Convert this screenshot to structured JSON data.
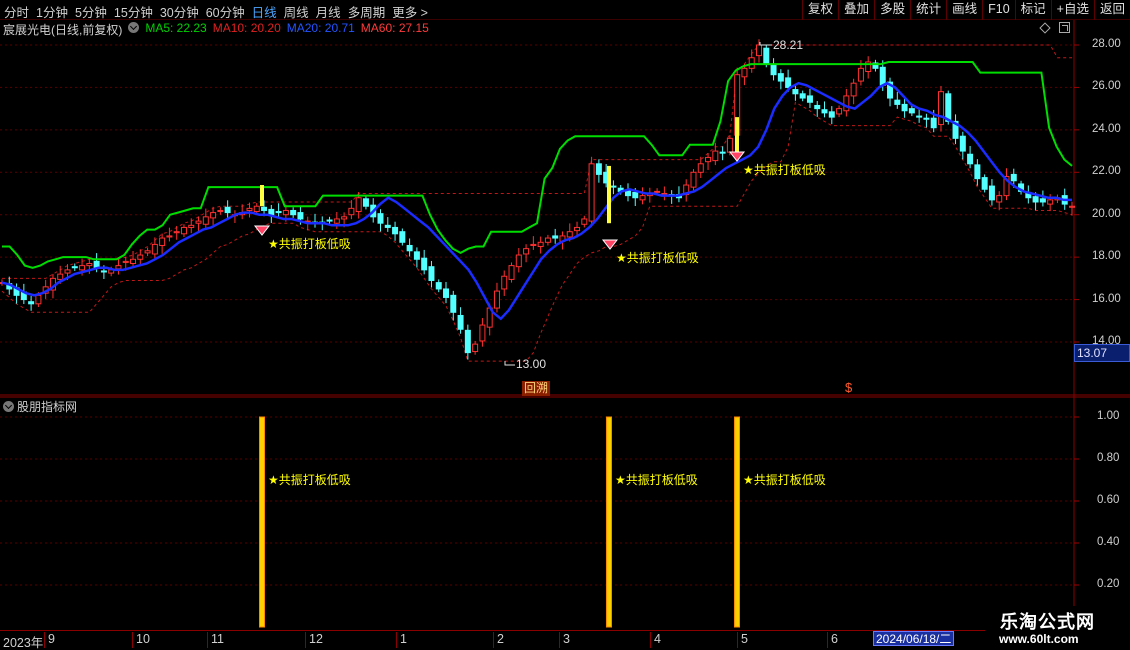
{
  "toolbar": {
    "periods": [
      {
        "label": "分时",
        "active": false
      },
      {
        "label": "1分钟",
        "active": false
      },
      {
        "label": "5分钟",
        "active": false
      },
      {
        "label": "15分钟",
        "active": false
      },
      {
        "label": "30分钟",
        "active": false
      },
      {
        "label": "60分钟",
        "active": false
      },
      {
        "label": "日线",
        "active": true
      },
      {
        "label": "周线",
        "active": false
      },
      {
        "label": "月线",
        "active": false
      },
      {
        "label": "多周期",
        "active": false
      },
      {
        "label": "更多 >",
        "active": false
      }
    ],
    "right_buttons": [
      "复权",
      "叠加",
      "多股",
      "统计",
      "画线",
      "F10",
      "标记",
      "+自选",
      "返回"
    ]
  },
  "info": {
    "stock_name": "宸展光电(日线,前复权)",
    "ma5": "MA5: 22.23",
    "ma10": "MA10: 20.20",
    "ma20": "MA20: 20.71",
    "ma60": "MA60: 27.15"
  },
  "subpanel": {
    "title": "股朋指标网"
  },
  "annotations": {
    "signal_label": "★共振打板低吸",
    "high_label": "28.21",
    "low_label": "13.00",
    "huitiao": "回溯",
    "dollar": "$"
  },
  "price_axis": [
    "28.00",
    "26.00",
    "24.00",
    "22.00",
    "20.00",
    "18.00",
    "16.00",
    "14.00"
  ],
  "current_price": "13.07",
  "sub_axis": [
    "1.00",
    "0.80",
    "0.60",
    "0.40",
    "0.20"
  ],
  "date_axis": {
    "labels": [
      "2023年",
      "9",
      "10",
      "11",
      "12",
      "1",
      "2",
      "3",
      "4",
      "5",
      "6"
    ],
    "selected_date": "2024/06/18/二"
  },
  "watermark": {
    "line1": "乐淘公式网",
    "line2": "www.60lt.com"
  },
  "colors": {
    "up": "#ff3030",
    "down": "#54ffff",
    "ma_green": "#00dd00",
    "ma_blue": "#1a2cff",
    "signal_text": "#ffff00",
    "bar": "#ffd000"
  },
  "chart_data": {
    "type": "candlestick",
    "ylim": [
      13.0,
      28.5
    ],
    "indicator_ylim": [
      0,
      1.05
    ],
    "signals": [
      {
        "name": "共振打板低吸",
        "value": 1.0
      },
      {
        "name": "共振打板低吸",
        "value": 1.0
      },
      {
        "name": "共振打板低吸",
        "value": 1.0
      }
    ],
    "price_path": [
      16.8,
      16.5,
      16.2,
      16.0,
      15.8,
      16.2,
      16.6,
      17.0,
      17.2,
      17.4,
      17.5,
      17.6,
      17.7,
      17.5,
      17.3,
      17.4,
      17.6,
      17.8,
      17.9,
      18.1,
      18.3,
      18.6,
      18.9,
      19.0,
      19.2,
      19.4,
      19.5,
      19.7,
      19.9,
      20.1,
      20.2,
      20.1,
      20.0,
      20.1,
      20.3,
      20.4,
      20.2,
      20.0,
      20.1,
      20.2,
      20.0,
      19.8,
      19.7,
      19.6,
      19.6,
      19.7,
      19.8,
      19.9,
      20.3,
      20.8,
      20.4,
      19.9,
      19.6,
      19.4,
      19.1,
      18.7,
      18.3,
      17.9,
      17.4,
      16.9,
      16.5,
      16.1,
      15.4,
      14.6,
      13.5,
      13.9,
      14.8,
      15.6,
      16.4,
      17.1,
      17.6,
      18.1,
      18.4,
      18.6,
      18.7,
      18.9,
      18.9,
      19.0,
      19.2,
      19.4,
      19.8,
      22.4,
      21.9,
      21.5,
      21.3,
      21.1,
      20.9,
      20.8,
      20.9,
      21.0,
      21.1,
      21.0,
      20.9,
      20.8,
      21.4,
      22.0,
      22.4,
      22.7,
      23.0,
      22.9,
      23.6,
      26.6,
      26.9,
      27.4,
      28.0,
      27.1,
      26.6,
      26.3,
      26.0,
      25.7,
      25.5,
      25.3,
      25.0,
      24.8,
      24.6,
      25.0,
      25.6,
      26.2,
      26.9,
      27.2,
      26.9,
      26.1,
      25.5,
      25.2,
      24.9,
      24.8,
      24.6,
      24.5,
      24.1,
      25.8,
      24.4,
      23.6,
      23.0,
      22.4,
      21.7,
      21.2,
      20.7,
      20.9,
      21.8,
      21.6,
      21.1,
      20.8,
      20.6,
      20.6,
      20.7,
      20.8,
      20.5,
      20.4
    ],
    "ma_blue": [
      16.8,
      16.7,
      16.5,
      16.3,
      16.2,
      16.3,
      16.5,
      16.8,
      17.0,
      17.2,
      17.3,
      17.4,
      17.5,
      17.5,
      17.4,
      17.4,
      17.5,
      17.6,
      17.7,
      17.9,
      18.1,
      18.4,
      18.7,
      18.9,
      19.1,
      19.3,
      19.4,
      19.6,
      19.8,
      20.0,
      20.1,
      20.1,
      20.0,
      20.0,
      19.9,
      19.8,
      19.8,
      19.7,
      19.6,
      19.6,
      19.6,
      19.5,
      19.5,
      19.5,
      19.6,
      19.8,
      20.1,
      20.5,
      20.8,
      20.6,
      20.3,
      20.0,
      19.7,
      19.4,
      19.0,
      18.6,
      18.2,
      17.8,
      17.4,
      16.8,
      16.1,
      15.4,
      15.1,
      15.5,
      16.1,
      16.7,
      17.3,
      17.9,
      18.3,
      18.6,
      18.8,
      18.9,
      19.1,
      19.4,
      19.8,
      20.3,
      20.8,
      21.1,
      21.2,
      21.1,
      21.0,
      21.0,
      20.9,
      20.9,
      20.9,
      21.0,
      21.1,
      21.3,
      21.6,
      21.9,
      22.2,
      22.4,
      22.6,
      22.8,
      23.2,
      24.0,
      25.0,
      25.6,
      26.0,
      26.2,
      26.1,
      25.9,
      25.7,
      25.5,
      25.3,
      25.1,
      25.0,
      25.3,
      25.6,
      26.0,
      26.2,
      26.0,
      25.6,
      25.2,
      25.0,
      24.9,
      24.7,
      24.6,
      24.4,
      24.2,
      23.9,
      23.5,
      23.0,
      22.5,
      22.0,
      21.6,
      21.3,
      21.1,
      21.0,
      20.9,
      20.8,
      20.8,
      20.7,
      20.7
    ],
    "ma_green": [
      18.5,
      18.5,
      18.1,
      17.6,
      17.5,
      17.6,
      17.8,
      17.9,
      18.0,
      18.0,
      18.0,
      18.0,
      17.9,
      17.9,
      17.9,
      17.9,
      18.1,
      18.6,
      19.0,
      19.3,
      19.3,
      19.5,
      20.0,
      20.1,
      20.2,
      20.3,
      20.3,
      21.3,
      21.3,
      21.3,
      21.3,
      21.3,
      21.3,
      21.3,
      21.3,
      21.3,
      21.3,
      20.4,
      20.4,
      20.4,
      20.4,
      20.4,
      20.9,
      20.9,
      20.9,
      20.9,
      20.9,
      20.9,
      20.9,
      20.9,
      20.9,
      20.9,
      20.9,
      20.9,
      20.9,
      20.9,
      20.0,
      19.3,
      18.8,
      18.4,
      18.2,
      18.4,
      18.5,
      18.5,
      19.2,
      19.2,
      19.2,
      19.2,
      19.2,
      19.4,
      19.6,
      21.7,
      22.2,
      23.1,
      23.5,
      23.7,
      23.7,
      23.7,
      23.7,
      23.7,
      23.7,
      23.7,
      23.7,
      23.7,
      23.7,
      23.3,
      22.8,
      22.8,
      22.8,
      22.8,
      23.3,
      23.3,
      23.3,
      23.3,
      24.4,
      26.3,
      26.8,
      27.0,
      27.1,
      27.1,
      27.1,
      27.1,
      27.1,
      27.1,
      27.1,
      27.1,
      27.1,
      27.1,
      27.1,
      27.1,
      27.1,
      27.1,
      27.1,
      27.1,
      27.1,
      27.1,
      27.2,
      27.2,
      27.2,
      27.2,
      27.2,
      27.2,
      27.2,
      27.2,
      27.2,
      27.2,
      27.2,
      27.2,
      26.7,
      26.7,
      26.7,
      26.7,
      26.7,
      26.7,
      26.7,
      26.7,
      26.7,
      24.1,
      23.2,
      22.6,
      22.3
    ]
  }
}
